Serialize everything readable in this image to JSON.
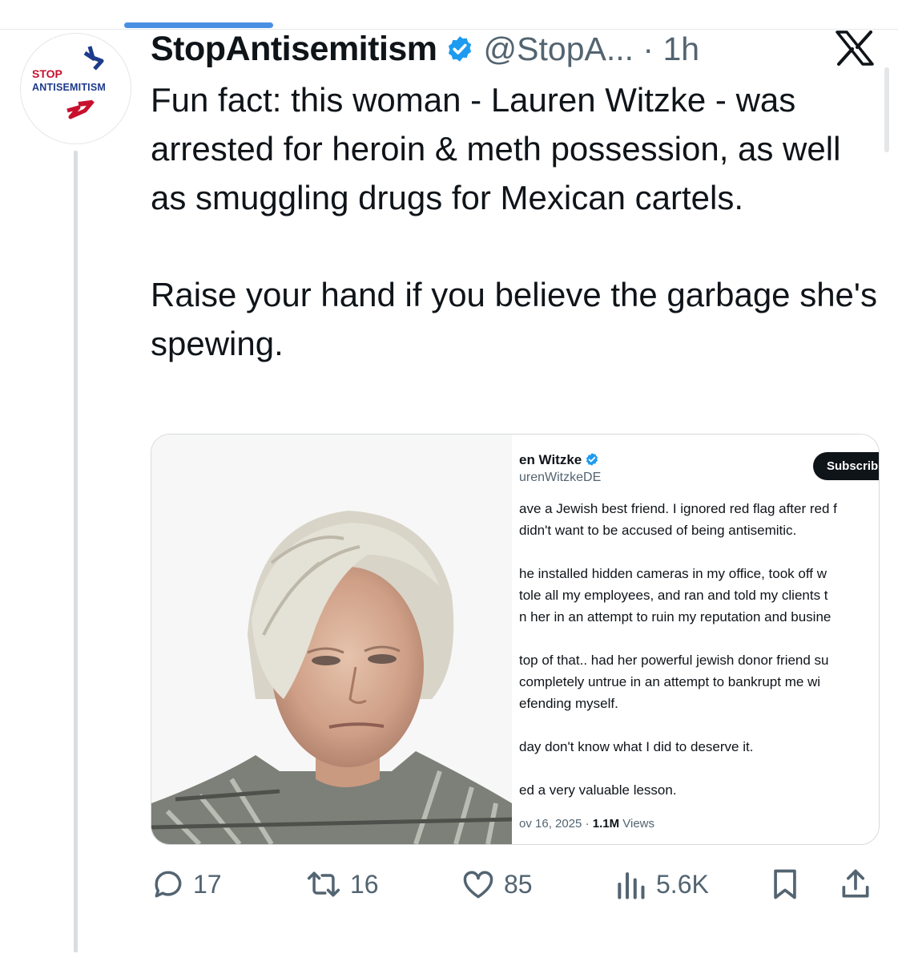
{
  "tweet": {
    "display_name": "StopAntisemitism",
    "handle_time": "@StopA... · 1h",
    "avatar_logo": {
      "line1": "STOP",
      "line2": "ANTISEMITISM"
    },
    "paragraphs": [
      "Fun fact: this woman - Lauren Witzke - was arrested for heroin & meth possession, as well as smuggling drugs for Mexican cartels.",
      "Raise your hand if you believe the garbage she's spewing."
    ],
    "colors": {
      "verified": "#1d9bf0",
      "text": "#0f1419",
      "muted": "#536471",
      "tab_indicator": "#4a90e2"
    }
  },
  "embedded_screenshot": {
    "name": "en Witzke",
    "handle": "urenWitzkeDE",
    "subscribe_label": "Subscrib",
    "lines": [
      "ave a Jewish best friend. I ignored red flag after red f",
      "didn't want to be accused of being antisemitic.",
      "he installed hidden cameras in my office, took off w",
      "tole all my employees, and ran and told my clients t",
      "n her in an attempt to ruin my reputation and busine",
      "top of that.. had her powerful jewish donor friend su",
      "completely untrue in an attempt to bankrupt me wi",
      "efending myself.",
      "day don't know what I did to deserve it.",
      "ed a very valuable lesson."
    ],
    "date": "ov 16, 2025 · ",
    "views_count": "1.1M",
    "views_label": " Views"
  },
  "actions": {
    "replies": "17",
    "reposts": "16",
    "likes": "85",
    "views": "5.6K"
  }
}
